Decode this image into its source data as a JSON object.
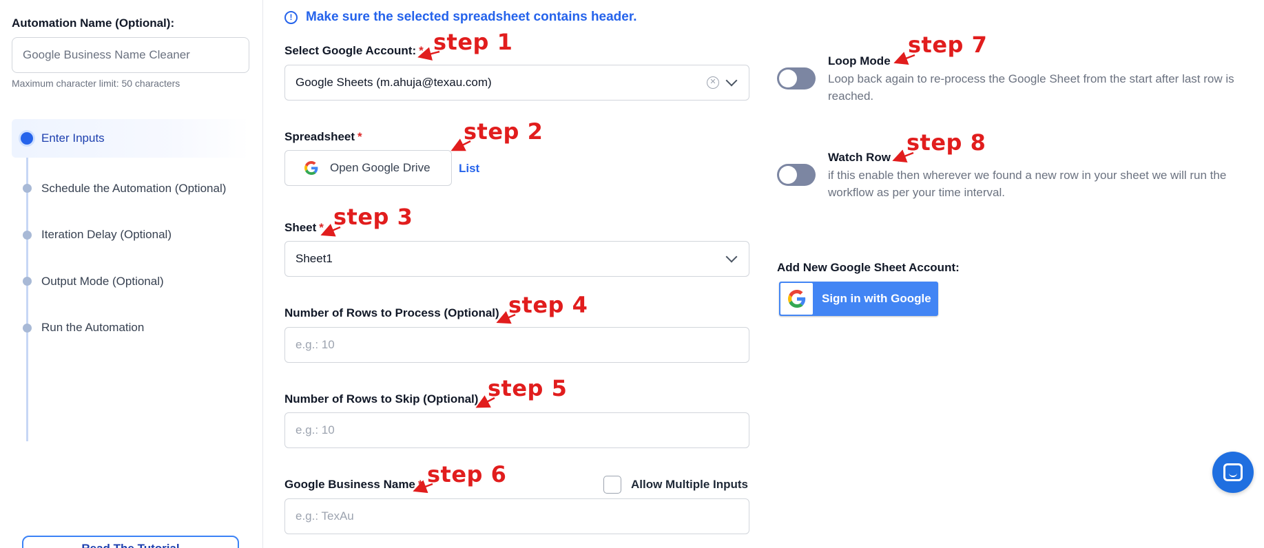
{
  "sidebar": {
    "automation_name_label": "Automation Name (Optional):",
    "automation_name_value": "Google Business Name Cleaner",
    "automation_name_hint": "Maximum character limit: 50 characters",
    "steps": [
      {
        "label": "Enter Inputs",
        "active": true
      },
      {
        "label": "Schedule the Automation (Optional)",
        "active": false
      },
      {
        "label": "Iteration Delay (Optional)",
        "active": false
      },
      {
        "label": "Output Mode (Optional)",
        "active": false
      },
      {
        "label": "Run the Automation",
        "active": false
      }
    ],
    "tutorial_button": "Read The Tutorial"
  },
  "form": {
    "notice": "Make sure the selected spreadsheet contains header.",
    "google_account": {
      "label": "Select Google Account:",
      "required_mark": "*",
      "value": "Google Sheets (m.ahuja@texau.com)"
    },
    "spreadsheet": {
      "label": "Spreadsheet",
      "required_mark": "*",
      "drive_button": "Open Google Drive",
      "list_link": "List"
    },
    "sheet": {
      "label": "Sheet",
      "required_mark": "*",
      "value": "Sheet1"
    },
    "rows_to_process": {
      "label": "Number of Rows to Process (Optional)",
      "placeholder": "e.g.: 10"
    },
    "rows_to_skip": {
      "label": "Number of Rows to Skip (Optional)",
      "placeholder": "e.g.: 10"
    },
    "business_name": {
      "label": "Google Business Name",
      "required_mark": "*",
      "placeholder": "e.g.: TexAu",
      "allow_multiple_label": "Allow Multiple Inputs"
    }
  },
  "options": {
    "loop_mode": {
      "title": "Loop Mode",
      "description": "Loop back again to re-process the Google Sheet from the start after last row is reached.",
      "enabled": false
    },
    "watch_row": {
      "title": "Watch Row",
      "description": "if this enable then wherever we found a new row in your sheet we will run the workflow as per your time interval.",
      "enabled": false
    },
    "add_account_label": "Add New Google Sheet Account:",
    "sign_in_button": "Sign in with Google"
  },
  "annotations": [
    "step 1",
    "step 2",
    "step 3",
    "step 4",
    "step 5",
    "step 6",
    "step 7",
    "step 8"
  ],
  "colors": {
    "accent": "#2563eb",
    "annotation": "#e11d1d",
    "google_blue": "#4285f4",
    "toggle_off": "#7c86a2"
  },
  "icons": {
    "notice": "info-circle-icon",
    "clear": "clear-circle-icon",
    "dropdown": "chevron-down-icon",
    "google": "google-logo-icon",
    "chat": "chat-icon"
  }
}
